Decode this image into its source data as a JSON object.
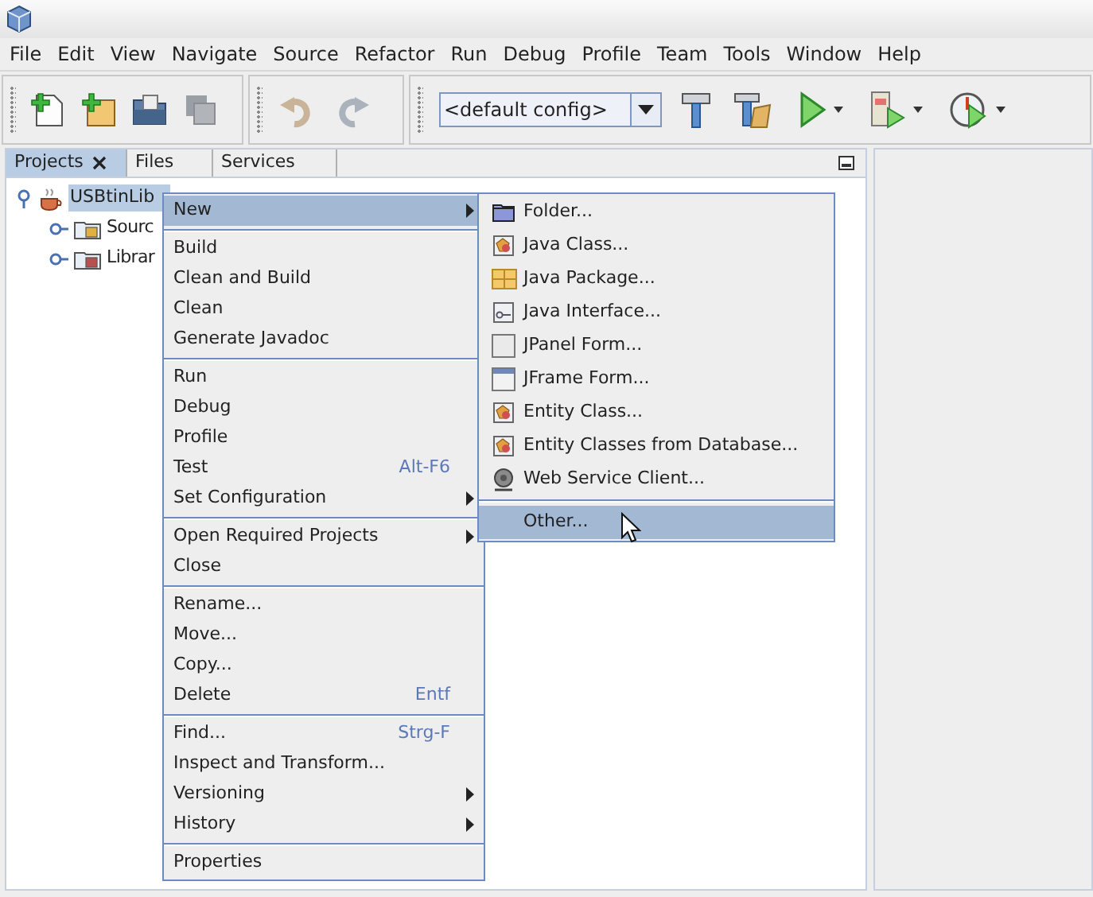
{
  "menu_bar": [
    "File",
    "Edit",
    "View",
    "Navigate",
    "Source",
    "Refactor",
    "Run",
    "Debug",
    "Profile",
    "Team",
    "Tools",
    "Window",
    "Help"
  ],
  "toolbar": {
    "config_combo": "<default config>"
  },
  "tabs": [
    {
      "label": "Projects",
      "selected": true,
      "closable": true
    },
    {
      "label": "Files",
      "selected": false,
      "closable": false
    },
    {
      "label": "Services",
      "selected": false,
      "closable": false
    }
  ],
  "tree": [
    {
      "label": "USBtinLib",
      "selected": true,
      "expanded": true,
      "children": [
        {
          "label": "Sourc",
          "expanded": false
        },
        {
          "label": "Librar",
          "expanded": false
        }
      ]
    }
  ],
  "context_menu": [
    {
      "kind": "item",
      "label": "New",
      "submenu": true,
      "selected": true
    },
    {
      "kind": "separator"
    },
    {
      "kind": "item",
      "label": "Build",
      "submenu": false,
      "selected": false
    },
    {
      "kind": "item",
      "label": "Clean and Build",
      "submenu": false,
      "selected": false
    },
    {
      "kind": "item",
      "label": "Clean",
      "submenu": false,
      "selected": false
    },
    {
      "kind": "item",
      "label": "Generate Javadoc",
      "submenu": false,
      "selected": false
    },
    {
      "kind": "separator"
    },
    {
      "kind": "item",
      "label": "Run",
      "submenu": false,
      "selected": false
    },
    {
      "kind": "item",
      "label": "Debug",
      "submenu": false,
      "selected": false
    },
    {
      "kind": "item",
      "label": "Profile",
      "submenu": false,
      "selected": false
    },
    {
      "kind": "item",
      "label": "Test",
      "shortcut": "Alt-F6",
      "submenu": false,
      "selected": false
    },
    {
      "kind": "item",
      "label": "Set Configuration",
      "submenu": true,
      "selected": false
    },
    {
      "kind": "separator"
    },
    {
      "kind": "item",
      "label": "Open Required Projects",
      "submenu": true,
      "selected": false
    },
    {
      "kind": "item",
      "label": "Close",
      "submenu": false,
      "selected": false
    },
    {
      "kind": "separator"
    },
    {
      "kind": "item",
      "label": "Rename...",
      "submenu": false,
      "selected": false
    },
    {
      "kind": "item",
      "label": "Move...",
      "submenu": false,
      "selected": false
    },
    {
      "kind": "item",
      "label": "Copy...",
      "submenu": false,
      "selected": false
    },
    {
      "kind": "item",
      "label": "Delete",
      "shortcut": "Entf",
      "submenu": false,
      "selected": false
    },
    {
      "kind": "separator"
    },
    {
      "kind": "item",
      "label": "Find...",
      "shortcut": "Strg-F",
      "submenu": false,
      "selected": false
    },
    {
      "kind": "item",
      "label": "Inspect and Transform...",
      "submenu": false,
      "selected": false
    },
    {
      "kind": "item",
      "label": "Versioning",
      "submenu": true,
      "selected": false
    },
    {
      "kind": "item",
      "label": "History",
      "submenu": true,
      "selected": false
    },
    {
      "kind": "separator"
    },
    {
      "kind": "item",
      "label": "Properties",
      "submenu": false,
      "selected": false
    }
  ],
  "submenu": [
    {
      "kind": "item",
      "label": "Folder...",
      "selected": false
    },
    {
      "kind": "item",
      "label": "Java Class...",
      "selected": false
    },
    {
      "kind": "item",
      "label": "Java Package...",
      "selected": false
    },
    {
      "kind": "item",
      "label": "Java Interface...",
      "selected": false
    },
    {
      "kind": "item",
      "label": "JPanel Form...",
      "selected": false
    },
    {
      "kind": "item",
      "label": "JFrame Form...",
      "selected": false
    },
    {
      "kind": "item",
      "label": "Entity Class...",
      "selected": false
    },
    {
      "kind": "item",
      "label": "Entity Classes from Database...",
      "selected": false
    },
    {
      "kind": "item",
      "label": "Web Service Client...",
      "selected": false
    },
    {
      "kind": "separator"
    },
    {
      "kind": "item",
      "label": "Other...",
      "selected": true
    }
  ]
}
